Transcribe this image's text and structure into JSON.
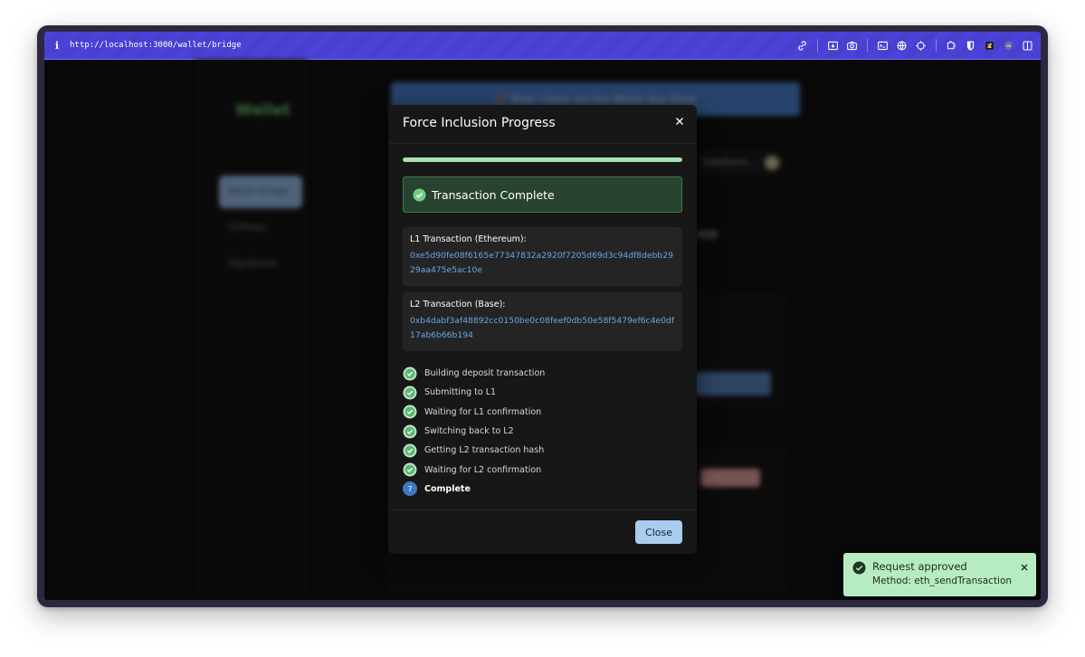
{
  "browser": {
    "url": "http://localhost:3000/wallet/bridge",
    "info_icon": "i",
    "toolbar_icons": [
      "link-icon",
      "screenshot-icon",
      "camera-icon",
      "terminal-icon",
      "globe-icon",
      "crosshair-icon",
      "extension-icon",
      "bitwarden-icon",
      "colorful-extension-icon",
      "ublock-icon",
      "sidebar-toggle-icon"
    ]
  },
  "background": {
    "brand": "Wallet",
    "nav": [
      "Wallet Bridge",
      "CCProxy",
      "Signatures"
    ],
    "banner": "🎉 New! Check out the Wallet App Store",
    "account_chip": "0xbpframo...",
    "partial_heading": "app"
  },
  "modal": {
    "title": "Force Inclusion Progress",
    "progress_fraction": 1.0,
    "status": "Transaction Complete",
    "l1": {
      "label": "L1 Transaction (Ethereum):",
      "hash": "0xe5d90fe08f6165e77347832a2920f7205d69d3c94df8debb2929aa475e5ac10e"
    },
    "l2": {
      "label": "L2 Transaction (Base):",
      "hash": "0xb4dabf3af48892cc0150be0c08feef0db50e58f5479ef6c4e0df17ab6b66b194"
    },
    "steps": [
      {
        "label": "Building deposit transaction",
        "done": true
      },
      {
        "label": "Submitting to L1",
        "done": true
      },
      {
        "label": "Waiting for L1 confirmation",
        "done": true
      },
      {
        "label": "Switching back to L2",
        "done": true
      },
      {
        "label": "Getting L2 transaction hash",
        "done": true
      },
      {
        "label": "Waiting for L2 confirmation",
        "done": true
      },
      {
        "label": "Complete",
        "done": false,
        "number": "7"
      }
    ],
    "close_label": "Close"
  },
  "toast": {
    "title": "Request approved",
    "message": "Method: eth_sendTransaction"
  },
  "colors": {
    "accent_blue": "#3e79c7",
    "success_green": "#6fcf85",
    "toast_bg": "#b7ecc2",
    "topbar": "#4b43d8"
  }
}
